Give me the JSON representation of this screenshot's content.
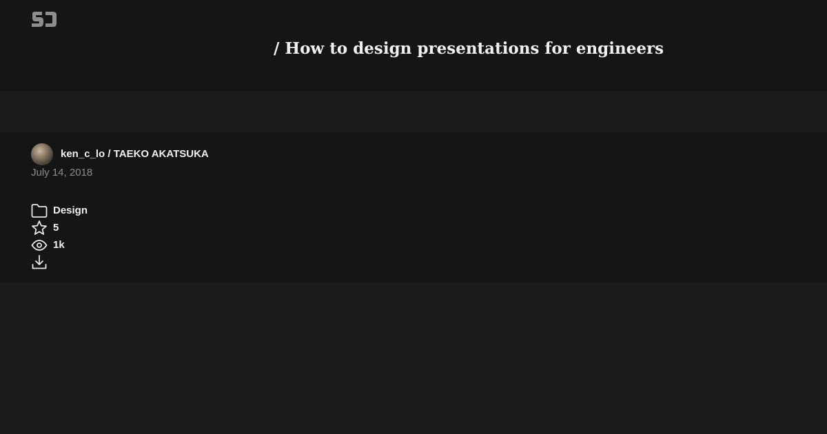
{
  "header": {
    "logo_icon": "speakerdeck-logo-icon",
    "title": "/ How to design presentations for engineers"
  },
  "author": {
    "name": "ken_c_lo / TAEKO AKATSUKA",
    "date": "July 14, 2018"
  },
  "stats": {
    "category": "Design",
    "stars": "5",
    "views": "1k"
  },
  "icons": {
    "category": "folder-icon",
    "stars": "star-icon",
    "views": "eye-icon",
    "download": "download-icon"
  },
  "colors": {
    "header_bg": "#151515",
    "page_bg": "#1b1b1b",
    "text": "#f0f0f0",
    "muted": "#8c8c8c"
  }
}
